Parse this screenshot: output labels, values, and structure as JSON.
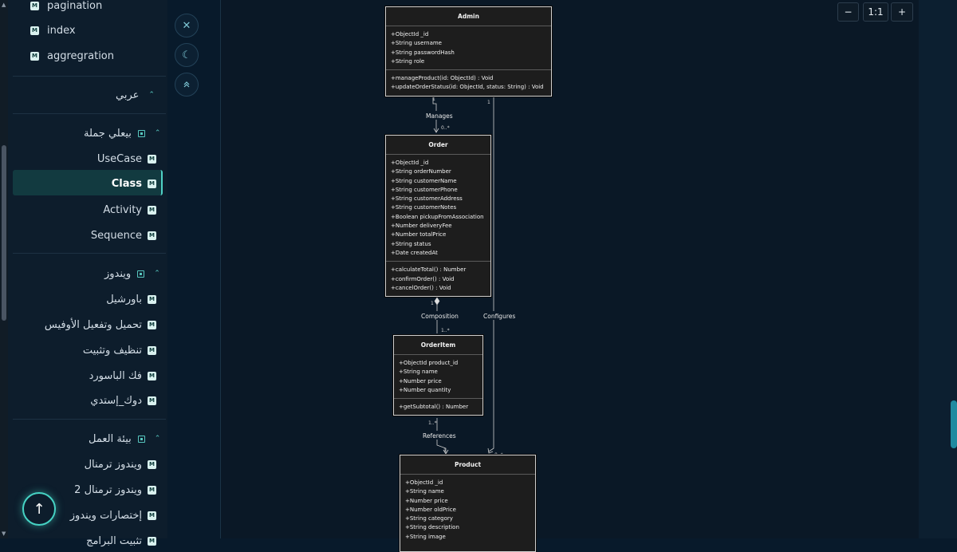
{
  "sidebar": {
    "badge": "M",
    "top_items": [
      "pagination",
      "index",
      "aggregration"
    ],
    "folders": {
      "arabic": "عربي",
      "sentence": "بيعلي جملة",
      "windows": "ويندوز",
      "workenv": "بيئة العمل"
    },
    "sentence_items": [
      "UseCase",
      "Class",
      "Activity",
      "Sequence"
    ],
    "windows_items": [
      "باورشيل",
      "تحميل وتفعيل الأوفيس",
      "تنظيف وتثبيت",
      "فك الباسورد",
      "دوك_إستدي"
    ],
    "workenv_items": [
      "ويندوز ترمنال",
      "ويندوز ترمنال 2",
      "إختصارات ويندوز",
      "تثبيت البرامج"
    ],
    "active_item": "Class"
  },
  "tools": {
    "close_icon": "close-icon",
    "theme_icon": "moon-icon",
    "collapse_icon": "double-chevron-up-icon"
  },
  "zoom": {
    "out": "−",
    "reset": "1:1",
    "in": "+"
  },
  "diagram": {
    "admin": {
      "name": "Admin",
      "attributes": [
        "+ObjectId _id",
        "+String username",
        "+String passwordHash",
        "+String role"
      ],
      "methods": [
        "+manageProduct(id: ObjectId) : Void",
        "+updateOrderStatus(id: ObjectId, status: String) : Void"
      ]
    },
    "order": {
      "name": "Order",
      "attributes": [
        "+ObjectId _id",
        "+String orderNumber",
        "+String customerName",
        "+String customerPhone",
        "+String customerAddress",
        "+String customerNotes",
        "+Boolean pickupFromAssociation",
        "+Number deliveryFee",
        "+Number totalPrice",
        "+String status",
        "+Date createdAt"
      ],
      "methods": [
        "+calculateTotal() : Number",
        "+confirmOrder() : Void",
        "+cancelOrder() : Void"
      ]
    },
    "orderitem": {
      "name": "OrderItem",
      "attributes": [
        "+ObjectId product_id",
        "+String name",
        "+Number price",
        "+Number quantity"
      ],
      "methods": [
        "+getSubtotal() : Number"
      ]
    },
    "product": {
      "name": "Product",
      "attributes": [
        "+ObjectId _id",
        "+String name",
        "+Number price",
        "+Number oldPrice",
        "+String category",
        "+String description",
        "+String image"
      ]
    },
    "edges": {
      "manages": "Manages",
      "composition": "Composition",
      "configures": "Configures",
      "references": "References",
      "m_one": "1",
      "m_many": "0..*",
      "m_one_many": "1..*"
    }
  }
}
